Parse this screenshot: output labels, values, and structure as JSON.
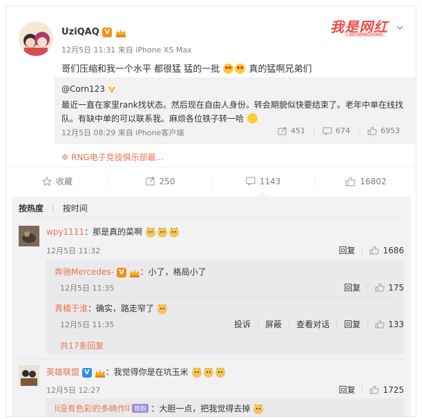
{
  "post": {
    "user_name": "UziQAQ",
    "meta": "12月5日 11:31 来自 iPhone XS Max",
    "text_a": "哥们压缩和我一个水平 都很猛 猛的一批",
    "text_b": "真的猛啊兄弟们",
    "watermark": "我是网红",
    "watermark_sub": "I AM WANGHONG"
  },
  "repost": {
    "user": "@Corn123",
    "text": "最近一直在家里rank找状态。然后现在自由人身份。转会期貌似快要结束了。老年中单在线找队。有缺中单的可以联系我。麻烦各位铁子转一哈",
    "meta": "12月5日 08:29 来自 iPhone客户端",
    "reposts": "451",
    "comments": "674",
    "likes": "6953"
  },
  "source_link": "RNG电子竞技俱乐部最...",
  "actions": {
    "favorite": "收藏",
    "reposts": "250",
    "comments": "1143",
    "likes": "16802"
  },
  "sort": {
    "hot": "按热度",
    "time": "按时间"
  },
  "comments": [
    {
      "name": "wpy1111",
      "text": "：那是真的菜啊",
      "date": "12月5日 11:32",
      "reply": "回复",
      "likes": "1686"
    },
    {
      "name": "英雄联盟",
      "text": "：我觉得你是在坑玉米",
      "date": "12月5日 12:27",
      "reply": "回复",
      "likes": "1725"
    }
  ],
  "replies": [
    {
      "name": "奔驰Mercedes-",
      "text": "：小了，格局小了",
      "date": "12月5日 11:35",
      "reply": "回复",
      "likes": "175"
    },
    {
      "name": "青橘于淮",
      "text": "：确实，路走窄了",
      "date": "12月5日 11:35",
      "report": "投诉",
      "block": "屏蔽",
      "view": "查看对话",
      "reply": "回复",
      "likes": "133"
    }
  ],
  "more_replies": "共17条回复",
  "partial_reply": {
    "name": "ll没有色彩的多崎作ll",
    "badge": "铁粉",
    "text": "：大胆一点，把我觉得去掉"
  },
  "colors": {
    "accent": "#eb7350",
    "verified": "#f68b1f",
    "panel": "#f2f2f5"
  }
}
